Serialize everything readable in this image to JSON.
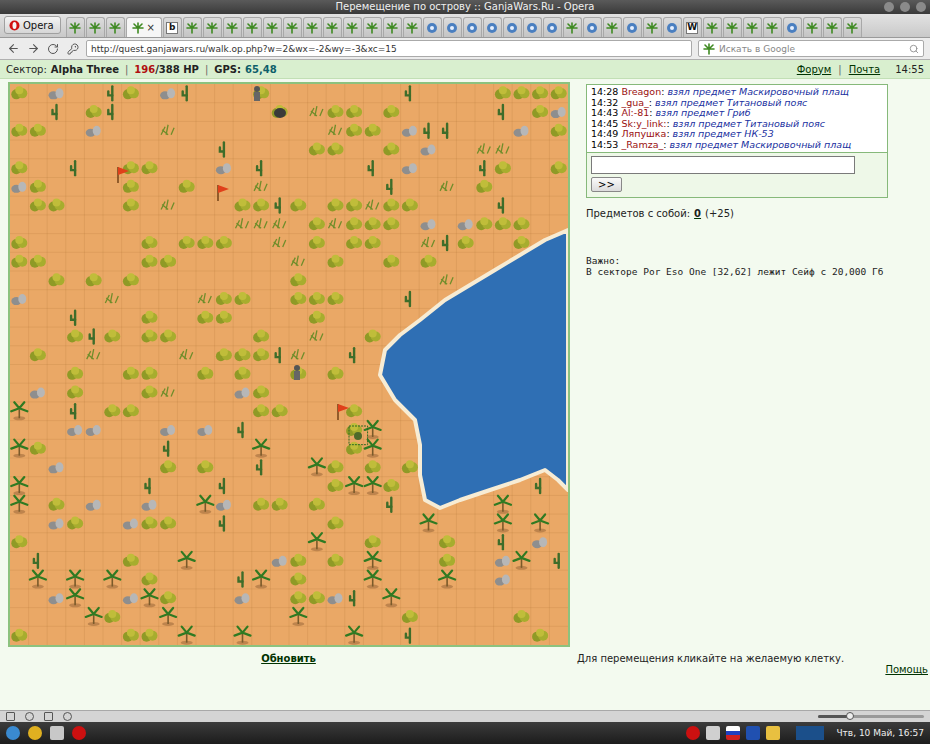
{
  "window": {
    "title": "Перемещение по острову :: GanjaWars.Ru - Opera"
  },
  "browser": {
    "menu": "Opera",
    "tabs": [
      {
        "kind": "leaf",
        "selected": false
      },
      {
        "kind": "leaf",
        "selected": false
      },
      {
        "kind": "leaf",
        "selected": false
      },
      {
        "kind": "leaf",
        "selected": true,
        "close": "×"
      },
      {
        "kind": "letter",
        "label": "b",
        "selected": false
      },
      {
        "kind": "leaf",
        "selected": false
      },
      {
        "kind": "leaf",
        "selected": false
      },
      {
        "kind": "leaf",
        "selected": false
      },
      {
        "kind": "leaf",
        "selected": false
      },
      {
        "kind": "leaf",
        "selected": false
      },
      {
        "kind": "leaf",
        "selected": false
      },
      {
        "kind": "leaf",
        "selected": false
      },
      {
        "kind": "leaf",
        "selected": false
      },
      {
        "kind": "leaf",
        "selected": false
      },
      {
        "kind": "leaf",
        "selected": false
      },
      {
        "kind": "leaf",
        "selected": false
      },
      {
        "kind": "leaf",
        "selected": false
      },
      {
        "kind": "other",
        "selected": false
      },
      {
        "kind": "other",
        "selected": false
      },
      {
        "kind": "other",
        "selected": false
      },
      {
        "kind": "other",
        "selected": false
      },
      {
        "kind": "other",
        "selected": false
      },
      {
        "kind": "other",
        "selected": false
      },
      {
        "kind": "other",
        "selected": false
      },
      {
        "kind": "leaf",
        "selected": false
      },
      {
        "kind": "other",
        "selected": false
      },
      {
        "kind": "leaf",
        "selected": false
      },
      {
        "kind": "other",
        "selected": false
      },
      {
        "kind": "leaf",
        "selected": false
      },
      {
        "kind": "other",
        "selected": false
      },
      {
        "kind": "letter",
        "label": "W",
        "selected": false
      },
      {
        "kind": "leaf",
        "selected": false
      },
      {
        "kind": "leaf",
        "selected": false
      },
      {
        "kind": "leaf",
        "selected": false
      },
      {
        "kind": "leaf",
        "selected": false
      },
      {
        "kind": "other",
        "selected": false
      },
      {
        "kind": "leaf",
        "selected": false
      },
      {
        "kind": "leaf",
        "selected": false
      },
      {
        "kind": "leaf",
        "selected": false
      }
    ],
    "address": "http://quest.ganjawars.ru/walk.op.php?w=2&wx=-2&wy=-3&xc=15",
    "search": {
      "placeholder": "Искать в Google"
    }
  },
  "status": {
    "sector_label": "Сектор:",
    "sector": "Alpha Three",
    "separator": "|",
    "hp": "196",
    "hp_max": "/388 HP",
    "gps_label": "GPS:",
    "gps": "65,48",
    "links": [
      "Форум",
      "Почта"
    ],
    "time": "14:55"
  },
  "chat": {
    "messages": [
      {
        "time": "14:28",
        "name": "Breagon",
        "text": "взял предмет Маскировочный плащ"
      },
      {
        "time": "14:32",
        "name": "_gua_",
        "text": "взял предмет Титановый пояс"
      },
      {
        "time": "14:43",
        "name": "Al:-81",
        "text": "взял предмет Гриб"
      },
      {
        "time": "14:45",
        "name": "Sk:y_link:",
        "text": "взял предмет Титановый пояс"
      },
      {
        "time": "14:49",
        "name": "Ляпушка",
        "text": "взял предмет НК-53"
      },
      {
        "time": "14:53",
        "name": "_Ramza_",
        "text": "взял предмет Маскировочный плащ"
      }
    ],
    "input": "",
    "send": ">>"
  },
  "items": {
    "label": "Предметов с собой:",
    "count": "0",
    "extra": "(+25)"
  },
  "notice": {
    "title": "Важно:",
    "text": "В секторе Por Eso One [32,62] лежит Сейф с 20,000 Гб"
  },
  "refresh": "Обновить",
  "hint": "Для перемещения кликайте на желаемую клетку.",
  "help": "Помощь",
  "zoom": {
    "level": 0.3
  },
  "taskbar": {
    "clock": "Чтв, 10 Май, 16:57"
  }
}
